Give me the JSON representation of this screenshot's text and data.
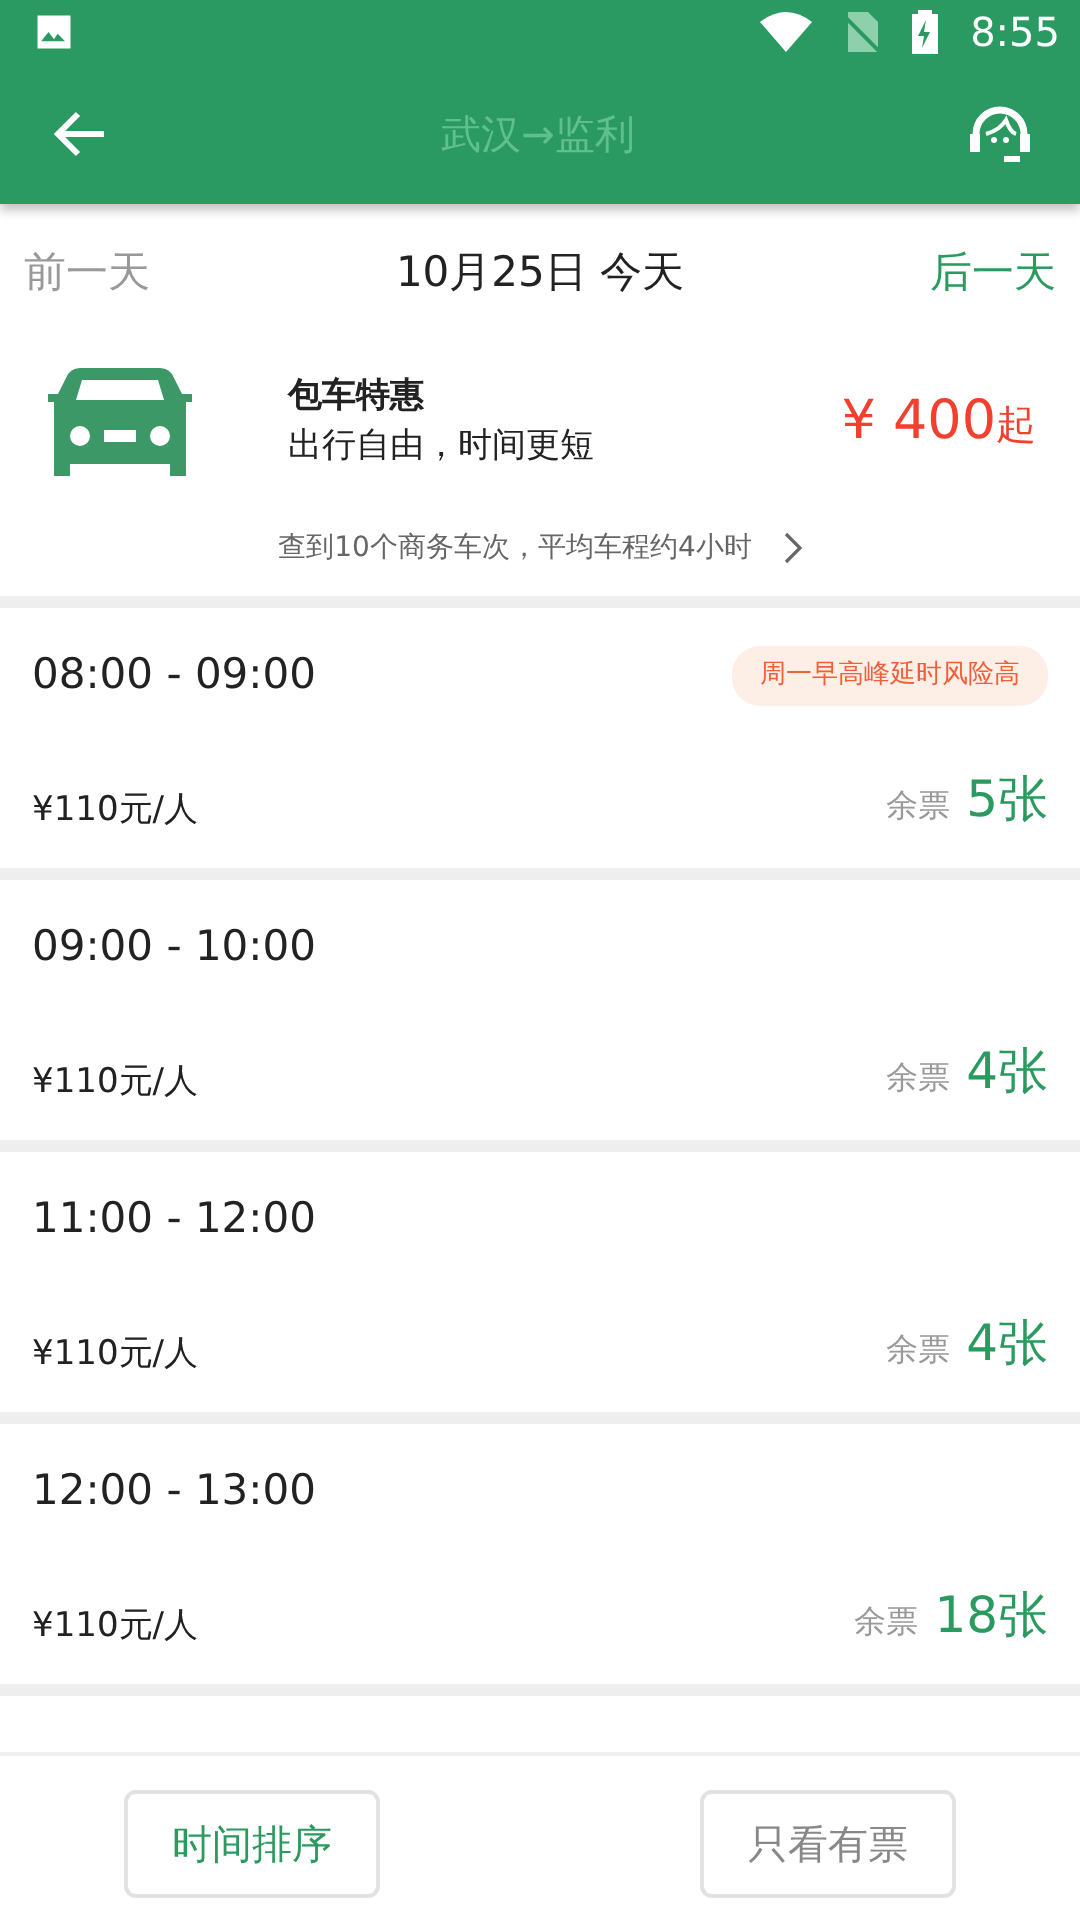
{
  "status_bar": {
    "time": "8:55"
  },
  "app_bar": {
    "title": "武汉→监利"
  },
  "date_nav": {
    "prev": {
      "label": "前一天",
      "disabled": true
    },
    "current": "10月25日 今天",
    "next": {
      "label": "后一天",
      "disabled": false
    }
  },
  "promo": {
    "title": "包车特惠",
    "subtitle": "出行自由，时间更短",
    "price": "¥ 400",
    "price_suffix": "起"
  },
  "summary": "查到10个商务车次，平均车程约4小时",
  "trips": [
    {
      "time": "08:00 - 09:00",
      "tag": "周一早高峰延时风险高",
      "price": "¥110元/人",
      "remain_label": "余票",
      "remain": "5张"
    },
    {
      "time": "09:00 - 10:00",
      "price": "¥110元/人",
      "remain_label": "余票",
      "remain": "4张"
    },
    {
      "time": "11:00 - 12:00",
      "price": "¥110元/人",
      "remain_label": "余票",
      "remain": "4张"
    },
    {
      "time": "12:00 - 13:00",
      "price": "¥110元/人",
      "remain_label": "余票",
      "remain": "18张"
    }
  ],
  "bottom_buttons": [
    {
      "label": "时间排序",
      "selected": true
    },
    {
      "label": "只看有票",
      "selected": false
    }
  ]
}
